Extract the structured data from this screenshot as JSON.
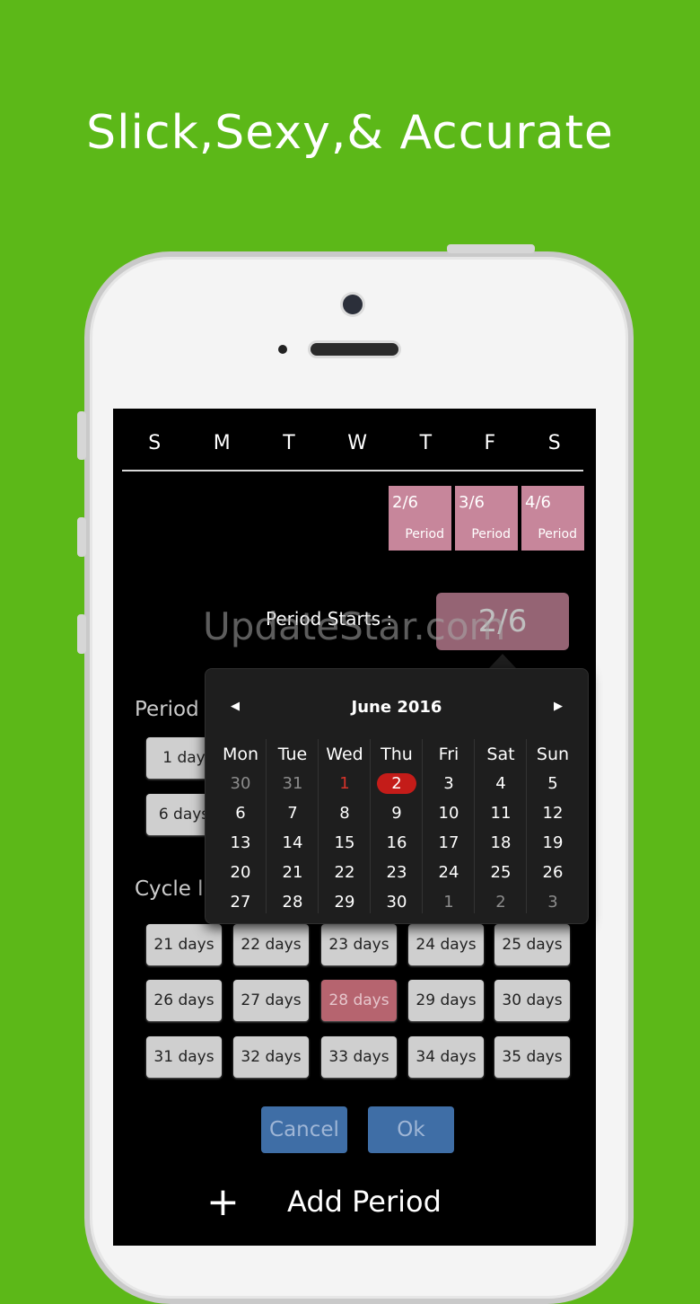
{
  "headline": "Slick,Sexy,& Accurate",
  "weekdays": [
    "S",
    "M",
    "T",
    "W",
    "T",
    "F",
    "S"
  ],
  "period_cells": [
    {
      "date": "2/6",
      "label": "Period"
    },
    {
      "date": "3/6",
      "label": "Period"
    },
    {
      "date": "4/6",
      "label": "Period"
    }
  ],
  "period_starts": {
    "label": "Period Starts :",
    "value": "2/6"
  },
  "watermark": "UpdateStar.com",
  "period_section_label": "Period",
  "period_duration_options": [
    "1 day",
    "6 days"
  ],
  "cycle_section_label": "Cycle l",
  "cycle_options": [
    "21 days",
    "22 days",
    "23 days",
    "24 days",
    "25 days",
    "26 days",
    "27 days",
    "28 days",
    "29 days",
    "30 days",
    "31 days",
    "32 days",
    "33 days",
    "34 days",
    "35 days"
  ],
  "cycle_selected": "28 days",
  "buttons": {
    "cancel": "Cancel",
    "ok": "Ok"
  },
  "add_period": {
    "icon": "plus-icon",
    "label": "Add Period"
  },
  "calendar": {
    "title": "June 2016",
    "day_headers": [
      "Mon",
      "Tue",
      "Wed",
      "Thu",
      "Fri",
      "Sat",
      "Sun"
    ],
    "weeks": [
      [
        "30",
        "31",
        "1",
        "2",
        "3",
        "4",
        "5"
      ],
      [
        "6",
        "7",
        "8",
        "9",
        "10",
        "11",
        "12"
      ],
      [
        "13",
        "14",
        "15",
        "16",
        "17",
        "18",
        "19"
      ],
      [
        "20",
        "21",
        "22",
        "23",
        "24",
        "25",
        "26"
      ],
      [
        "27",
        "28",
        "29",
        "30",
        "1",
        "2",
        "3"
      ]
    ],
    "selected": "2",
    "today": "1",
    "colors": {
      "selected": "#c41c19",
      "today": "#d6332a"
    }
  },
  "colors": {
    "background": "#5cb818",
    "period_pink": "#c7869b",
    "button_blue": "#3f6ea6"
  }
}
